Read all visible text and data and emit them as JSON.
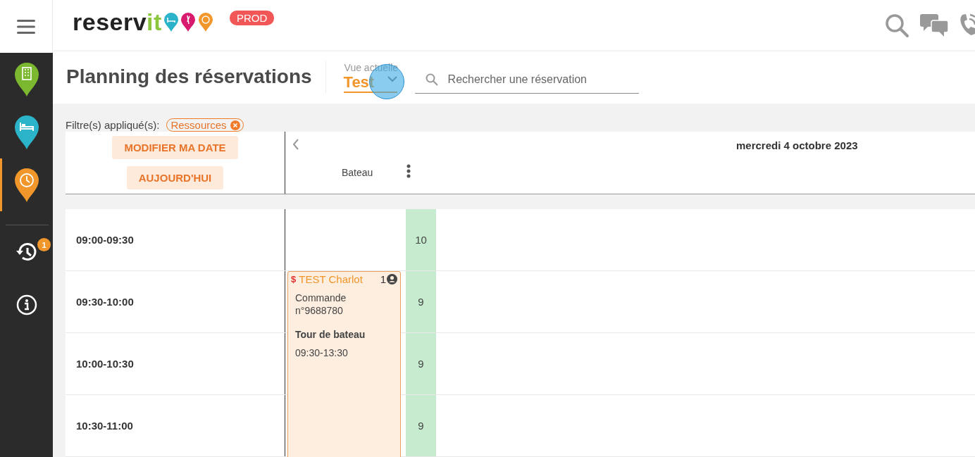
{
  "logo": {
    "parts": [
      "reserv",
      "it"
    ],
    "env_badge": "PROD"
  },
  "sidebar": {
    "items": [
      {
        "kind": "building",
        "color": "#7cb82f",
        "selected": false
      },
      {
        "kind": "bed",
        "color": "#2bb3c9",
        "selected": false
      },
      {
        "kind": "clock",
        "color": "#f0962a",
        "selected": true
      },
      {
        "kind": "history",
        "badge": "1",
        "selected": false
      },
      {
        "kind": "info",
        "selected": false
      }
    ]
  },
  "page_title": "Planning des réservations",
  "view_select": {
    "label": "Vue actuelle",
    "value": "Test"
  },
  "search": {
    "placeholder": "Rechercher une réservation"
  },
  "filters": {
    "label": "Filtre(s) appliqué(s):",
    "chips": [
      "Ressources"
    ]
  },
  "buttons": [
    "MODIFIER MA DATE",
    "AUJOURD'HUI"
  ],
  "date_header": "mercredi 4 octobre 2023",
  "resource": "Bateau",
  "rows": [
    {
      "time": "09:00-09:30",
      "count": "10"
    },
    {
      "time": "09:30-10:00",
      "count": "9"
    },
    {
      "time": "10:00-10:30",
      "count": "9"
    },
    {
      "time": "10:30-11:00",
      "count": "9"
    }
  ],
  "booking": {
    "name": "TEST Charlot",
    "paid_mark": "$",
    "guests": "1",
    "order": "Commande n°9688780",
    "activity": "Tour de bateau",
    "time": "09:30-13:30"
  }
}
